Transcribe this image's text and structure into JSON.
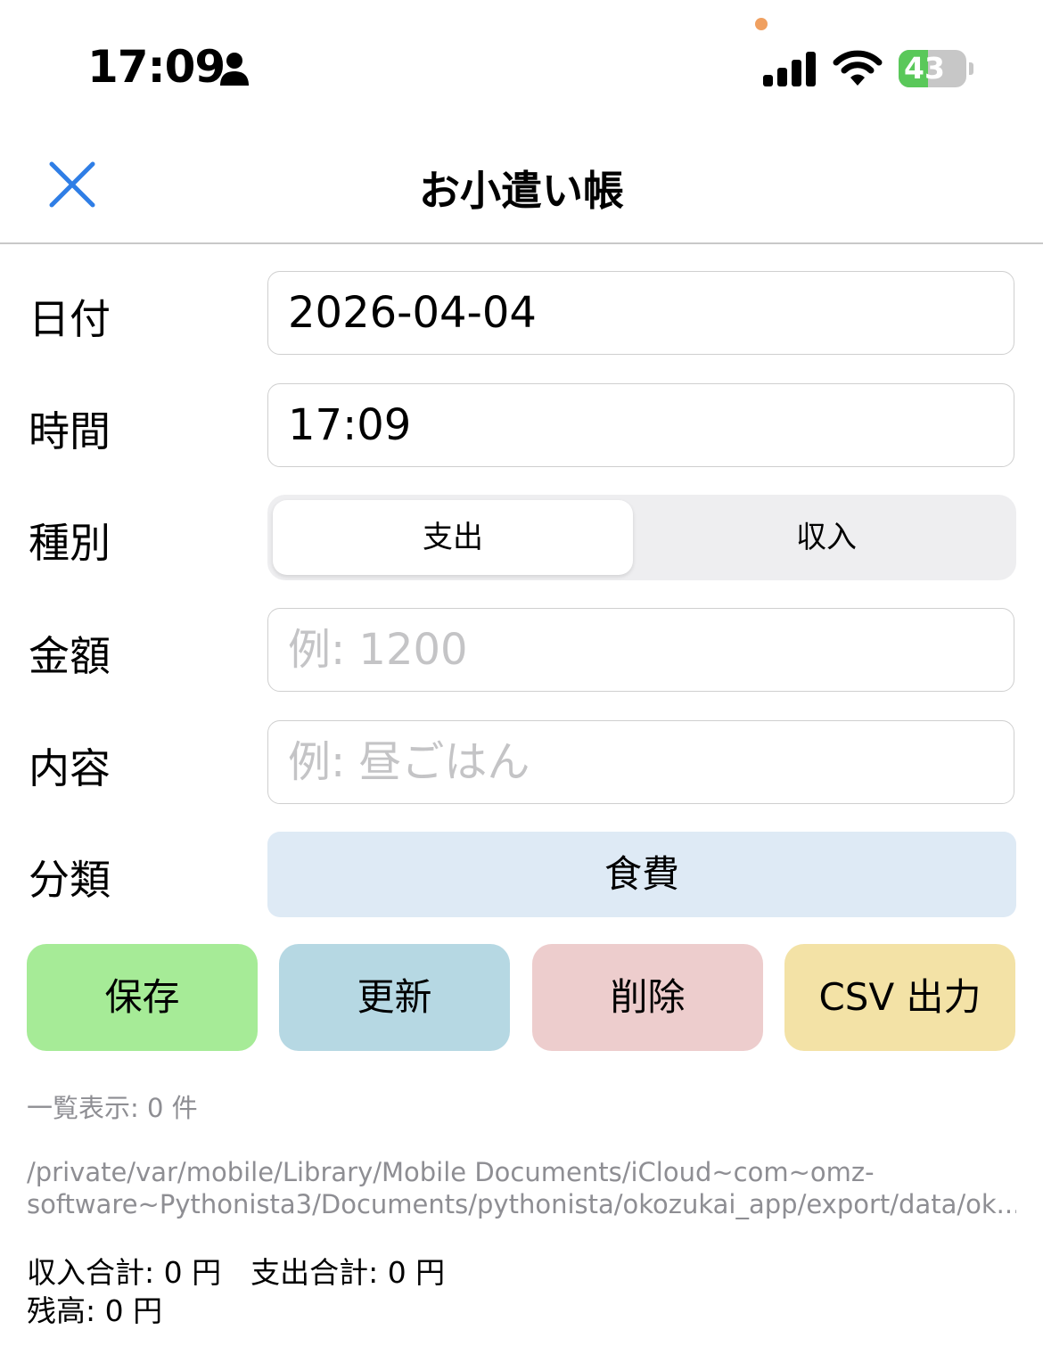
{
  "status_bar": {
    "time": "17:09",
    "battery_level": "43",
    "battery_fraction": 0.43,
    "battery_color": "#5ac85a",
    "indicator_dot_color": "#f0a060"
  },
  "nav": {
    "title": "お小遣い帳",
    "close_icon": "close-icon"
  },
  "form": {
    "date": {
      "label": "日付",
      "value": "2026-04-04"
    },
    "time": {
      "label": "時間",
      "value": "17:09"
    },
    "type": {
      "label": "種別",
      "options": [
        "支出",
        "収入"
      ],
      "selected": "支出"
    },
    "amount": {
      "label": "金額",
      "placeholder": "例: 1200"
    },
    "content": {
      "label": "内容",
      "placeholder": "例: 昼ごはん"
    },
    "category": {
      "label": "分類",
      "value": "食費"
    }
  },
  "buttons": {
    "save": "保存",
    "update": "更新",
    "delete": "削除",
    "csv": "CSV 出力"
  },
  "info": {
    "count": "一覧表示: 0 件",
    "path_line1": "/private/var/mobile/Library/Mobile Documents/iCloud~com~omz-",
    "path_line2": "software~Pythonista3/Documents/pythonista/okozukai_app/export/data/ok..."
  },
  "totals": {
    "line1": "収入合計: 0 円　支出合計: 0 円",
    "line2": "残高: 0 円"
  },
  "colors": {
    "accent": "#2f7ee6",
    "save": "#a6eb97",
    "update": "#b6d8e3",
    "delete": "#edcdcd",
    "csv": "#f3e2a6",
    "category_bg": "#deeaf5"
  }
}
